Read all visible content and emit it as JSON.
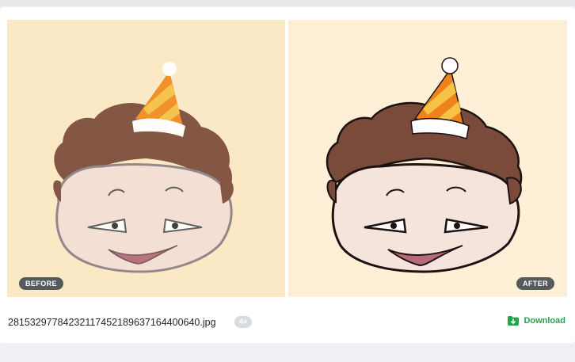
{
  "comparison": {
    "before_label": "BEFORE",
    "after_label": "AFTER"
  },
  "file": {
    "name": "28153297784232117452189637164400640.jpg",
    "scale": "4×"
  },
  "actions": {
    "download_label": "Download"
  },
  "icons": {
    "download": "folder-download-icon"
  },
  "colors": {
    "accent_green": "#23a64a",
    "badge_bg": "#555a5c",
    "before_bg": "#fbe8c5",
    "after_bg": "#fdf0d6"
  }
}
